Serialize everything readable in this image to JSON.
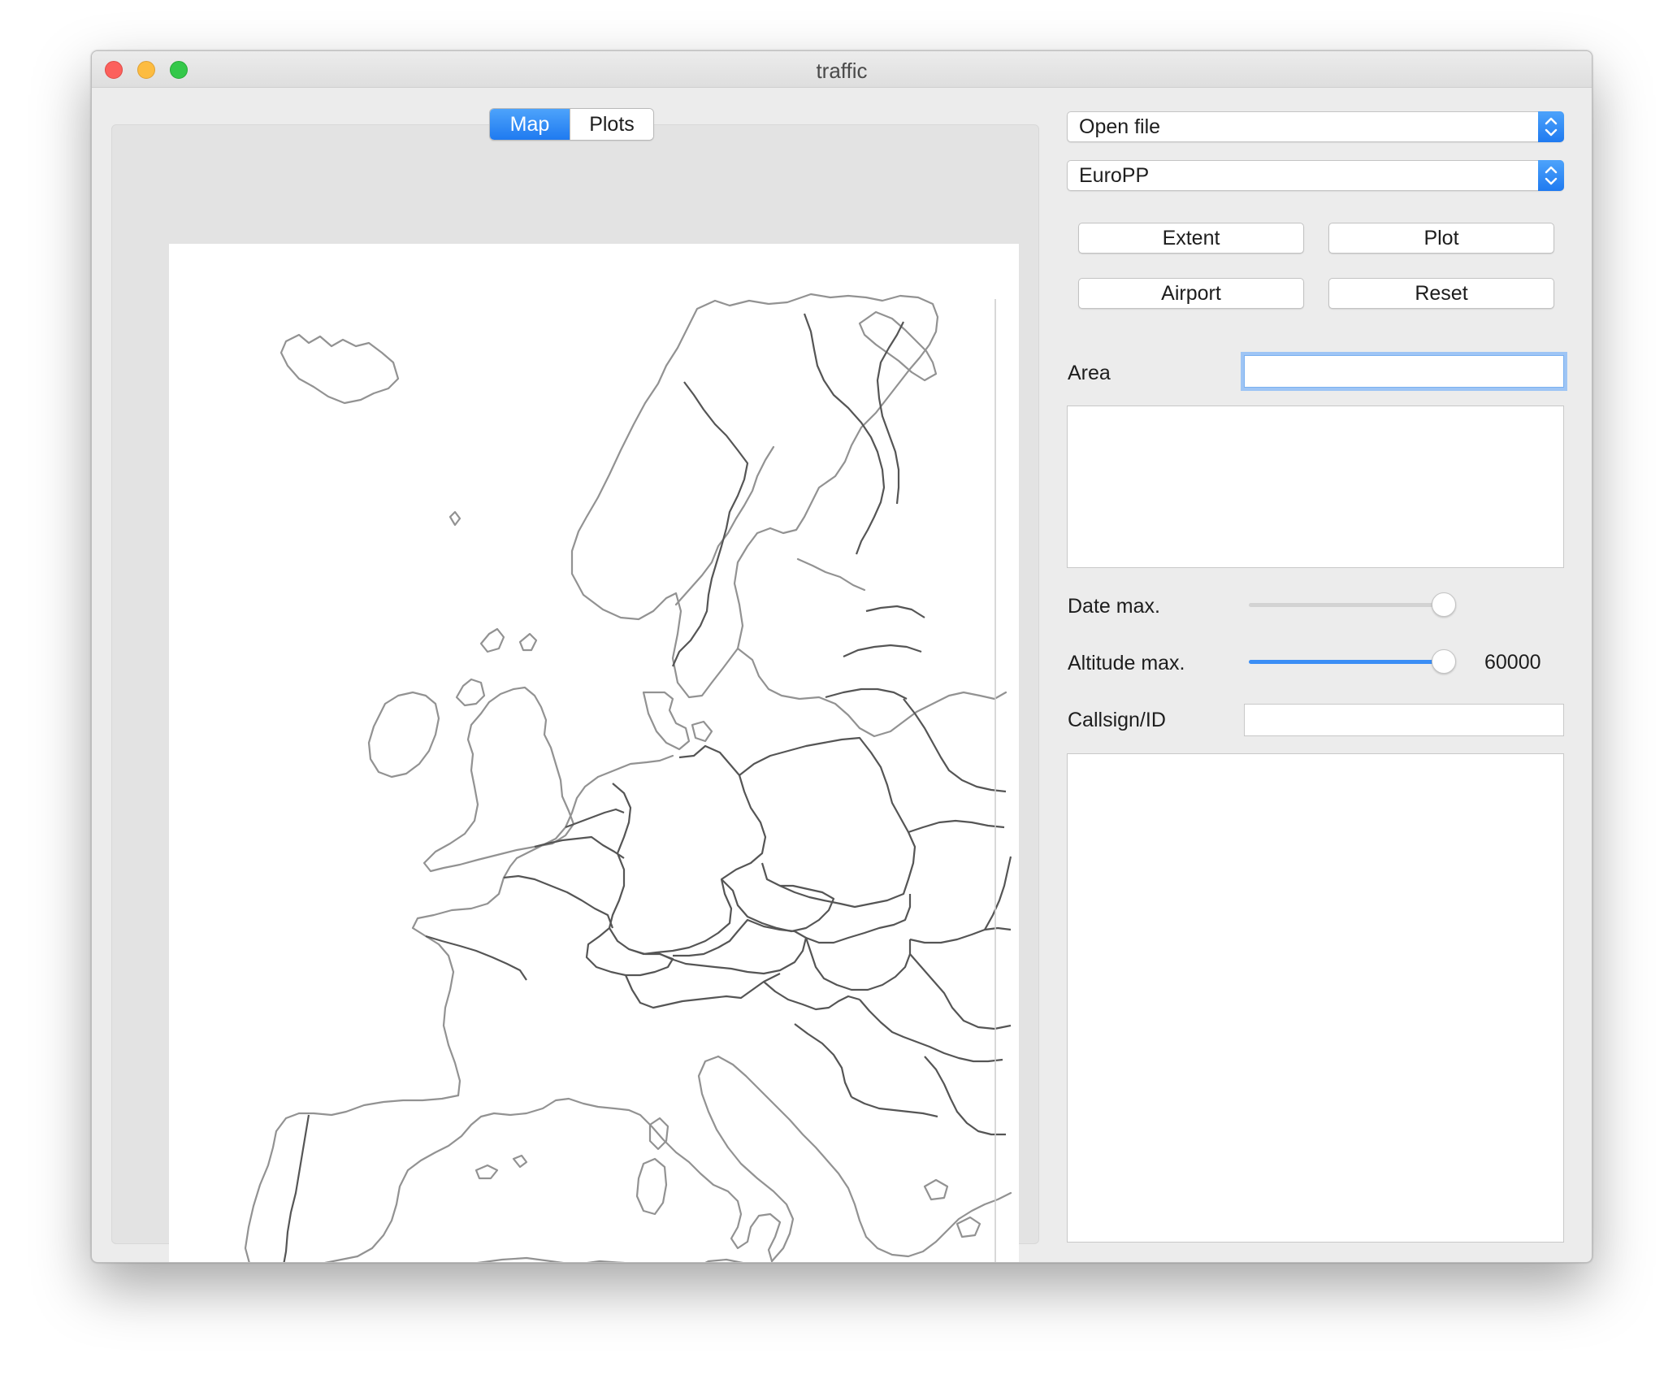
{
  "window": {
    "title": "traffic"
  },
  "tabs": [
    {
      "label": "Map",
      "active": true
    },
    {
      "label": "Plots",
      "active": false
    }
  ],
  "map": {
    "projection_label": "EuroPP",
    "stroke_color": "#8f8f8f"
  },
  "controls": {
    "open_file": "Open file",
    "projection": "EuroPP",
    "buttons": {
      "extent": "Extent",
      "plot": "Plot",
      "airport": "Airport",
      "reset": "Reset"
    },
    "area_label": "Area",
    "area_value": "",
    "date_max_label": "Date max.",
    "date_max_level": 1.0,
    "altitude_max_label": "Altitude max.",
    "altitude_max_value": "60000",
    "altitude_max_level": 1.0,
    "callsign_label": "Callsign/ID",
    "callsign_value": ""
  },
  "colors": {
    "accent": "#1f7af0",
    "focus_ring": "#9ec5f5"
  }
}
